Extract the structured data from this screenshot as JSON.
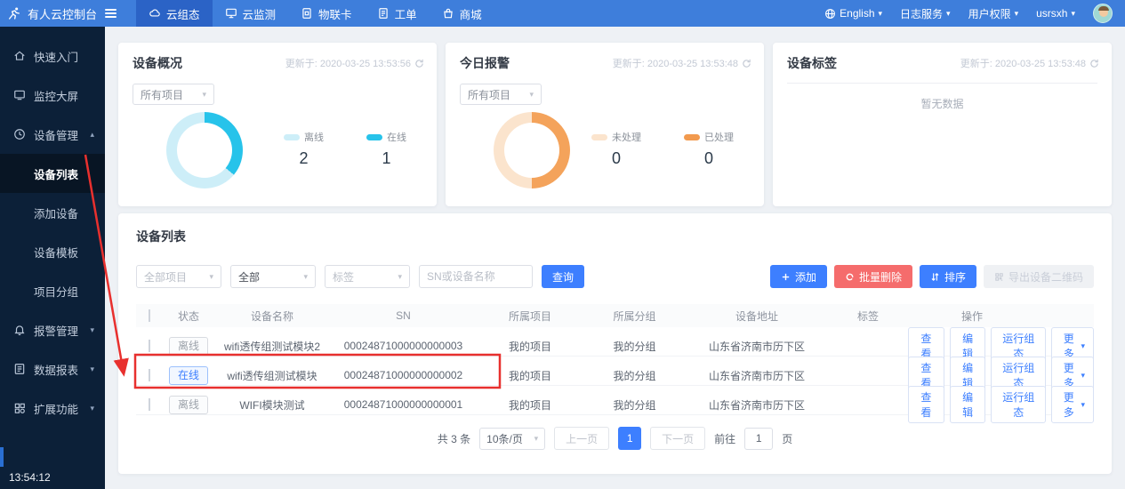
{
  "topbar": {
    "brand": "有人云控制台",
    "tabs": [
      {
        "label": "云组态",
        "active": true
      },
      {
        "label": "云监测",
        "active": false
      },
      {
        "label": "物联卡",
        "active": false
      },
      {
        "label": "工单",
        "active": false
      },
      {
        "label": "商城",
        "active": false
      }
    ],
    "right": {
      "language": "English",
      "log_service": "日志服务",
      "permissions": "用户权限",
      "username": "usrsxh"
    }
  },
  "sidebar": {
    "items": [
      {
        "label": "快速入门"
      },
      {
        "label": "监控大屏"
      },
      {
        "label": "设备管理"
      },
      {
        "label": "设备列表"
      },
      {
        "label": "添加设备"
      },
      {
        "label": "设备模板"
      },
      {
        "label": "项目分组"
      },
      {
        "label": "报警管理"
      },
      {
        "label": "数据报表"
      },
      {
        "label": "扩展功能"
      }
    ],
    "clock": "13:54:12"
  },
  "cards": {
    "device_overview": {
      "title": "设备概况",
      "updated": "更新于: 2020-03-25 13:53:56",
      "filter": "所有项目",
      "donut": {
        "deg": 130,
        "color": "#27c3ea",
        "rest": "#cdeef8"
      },
      "legend": [
        {
          "label": "离线",
          "value": "2",
          "color": "#cdeef8"
        },
        {
          "label": "在线",
          "value": "1",
          "color": "#27c3ea"
        }
      ]
    },
    "today_alarms": {
      "title": "今日报警",
      "updated": "更新于: 2020-03-25 13:53:48",
      "filter": "所有项目",
      "donut": {
        "deg": 180,
        "color": "#f4a35b",
        "rest": "#fbe4cd"
      },
      "legend": [
        {
          "label": "未处理",
          "value": "0",
          "color": "#fbe4cd"
        },
        {
          "label": "已处理",
          "value": "0",
          "color": "#f29a4e"
        }
      ]
    },
    "device_tags": {
      "title": "设备标签",
      "updated": "更新于: 2020-03-25 13:53:48",
      "empty": "暂无数据"
    }
  },
  "device_list": {
    "title": "设备列表",
    "filters": {
      "project": "全部项目",
      "status": "全部",
      "tag_placeholder": "标签",
      "search_placeholder": "SN或设备名称",
      "search_button": "查询"
    },
    "toolbar": {
      "add": "添加",
      "bulk_delete": "批量删除",
      "sort": "排序",
      "export_qr": "导出设备二维码"
    },
    "columns": [
      "状态",
      "设备名称",
      "SN",
      "所属项目",
      "所属分组",
      "设备地址",
      "标签",
      "操作"
    ],
    "row_actions": [
      "查看",
      "编辑",
      "运行组态",
      "更多"
    ],
    "rows": [
      {
        "status": "离线",
        "name": "wifi透传组测试模块2",
        "sn": "00024871000000000003",
        "project": "我的项目",
        "group": "我的分组",
        "address": "山东省济南市历下区",
        "tag": ""
      },
      {
        "status": "在线",
        "name": "wifi透传组测试模块",
        "sn": "00024871000000000002",
        "project": "我的项目",
        "group": "我的分组",
        "address": "山东省济南市历下区",
        "tag": ""
      },
      {
        "status": "离线",
        "name": "WIFI模块测试",
        "sn": "00024871000000000001",
        "project": "我的项目",
        "group": "我的分组",
        "address": "山东省济南市历下区",
        "tag": ""
      }
    ],
    "pagination": {
      "total": "共 3 条",
      "page_size": "10条/页",
      "prev": "上一页",
      "page": "1",
      "next": "下一页",
      "goto_prefix": "前往",
      "goto_value": "1",
      "goto_suffix": "页"
    }
  },
  "annotation": {
    "color": "#e8302e"
  },
  "palette": {
    "accent_blue": "#3d7fff",
    "danger_red": "#f56c6c",
    "navbar_blue": "#3e7edb",
    "sidebar_navy": "#0c2038"
  }
}
